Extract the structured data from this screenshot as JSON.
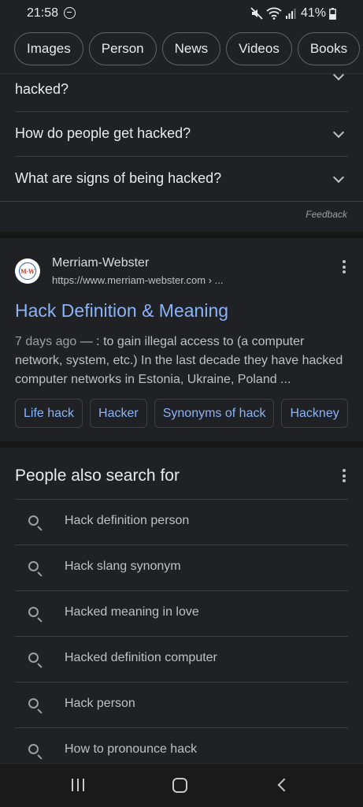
{
  "status_bar": {
    "time": "21:58",
    "battery": "41%"
  },
  "chips": [
    "Images",
    "Person",
    "News",
    "Videos",
    "Books"
  ],
  "faq": {
    "partial_question": "hacked?",
    "questions": [
      "How do people get hacked?",
      "What are signs of being hacked?"
    ],
    "feedback": "Feedback"
  },
  "result": {
    "favicon_text": "M·W",
    "site_name": "Merriam-Webster",
    "url": "https://www.merriam-webster.com › ...",
    "title": "Hack Definition & Meaning",
    "date": "7 days ago",
    "snippet": " — : to gain illegal access to (a computer network, system, etc.) In the last decade they have hacked computer networks in Estonia, Ukraine, Poland ...",
    "related": [
      "Life hack",
      "Hacker",
      "Synonyms of hack",
      "Hackney"
    ]
  },
  "people_also_search": {
    "title": "People also search for",
    "items": [
      "Hack definition person",
      "Hack slang synonym",
      "Hacked meaning in love",
      "Hacked definition computer",
      "Hack person",
      "How to pronounce hack"
    ]
  },
  "colors": {
    "background": "#202124",
    "link": "#8ab4f8",
    "text": "#e8eaed",
    "secondary_text": "#bdc1c6"
  }
}
